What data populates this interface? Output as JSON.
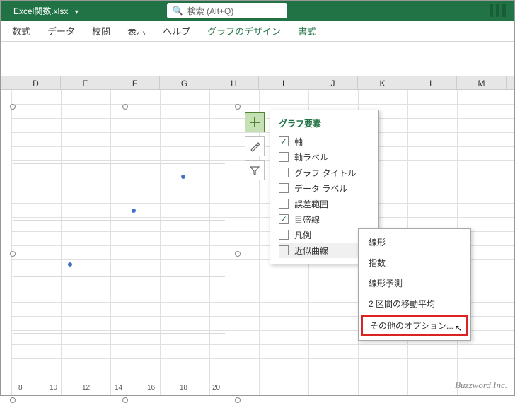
{
  "title": {
    "filename": "Excel関数.xlsx"
  },
  "search": {
    "placeholder": "検索 (Alt+Q)"
  },
  "menu": {
    "items": [
      "数式",
      "データ",
      "校閲",
      "表示",
      "ヘルプ",
      "グラフのデザイン",
      "書式"
    ],
    "active_from": 5
  },
  "columns": [
    "D",
    "E",
    "F",
    "G",
    "H",
    "I",
    "J",
    "K",
    "L",
    "M"
  ],
  "chart_data": {
    "type": "scatter",
    "x": [
      11,
      15,
      18
    ],
    "y": [
      1,
      2,
      3
    ],
    "xlim": [
      8,
      20
    ],
    "xticks": [
      8,
      10,
      12,
      14,
      16,
      18,
      20
    ],
    "title": "",
    "xlabel": "",
    "ylabel": ""
  },
  "side_buttons": {
    "add": "plus-icon",
    "brush": "brush-icon",
    "filter": "filter-icon"
  },
  "popup": {
    "title": "グラフ要素",
    "items": [
      {
        "label": "軸",
        "checked": true
      },
      {
        "label": "軸ラベル",
        "checked": false
      },
      {
        "label": "グラフ タイトル",
        "checked": false
      },
      {
        "label": "データ ラベル",
        "checked": false
      },
      {
        "label": "誤差範囲",
        "checked": false
      },
      {
        "label": "目盛線",
        "checked": true
      },
      {
        "label": "凡例",
        "checked": false
      },
      {
        "label": "近似曲線",
        "checked": false,
        "arrow": true
      }
    ]
  },
  "submenu": {
    "items": [
      "線形",
      "指数",
      "線形予測",
      "2 区間の移動平均"
    ],
    "highlighted": "その他のオプション..."
  },
  "watermark": "Buzzword Inc."
}
